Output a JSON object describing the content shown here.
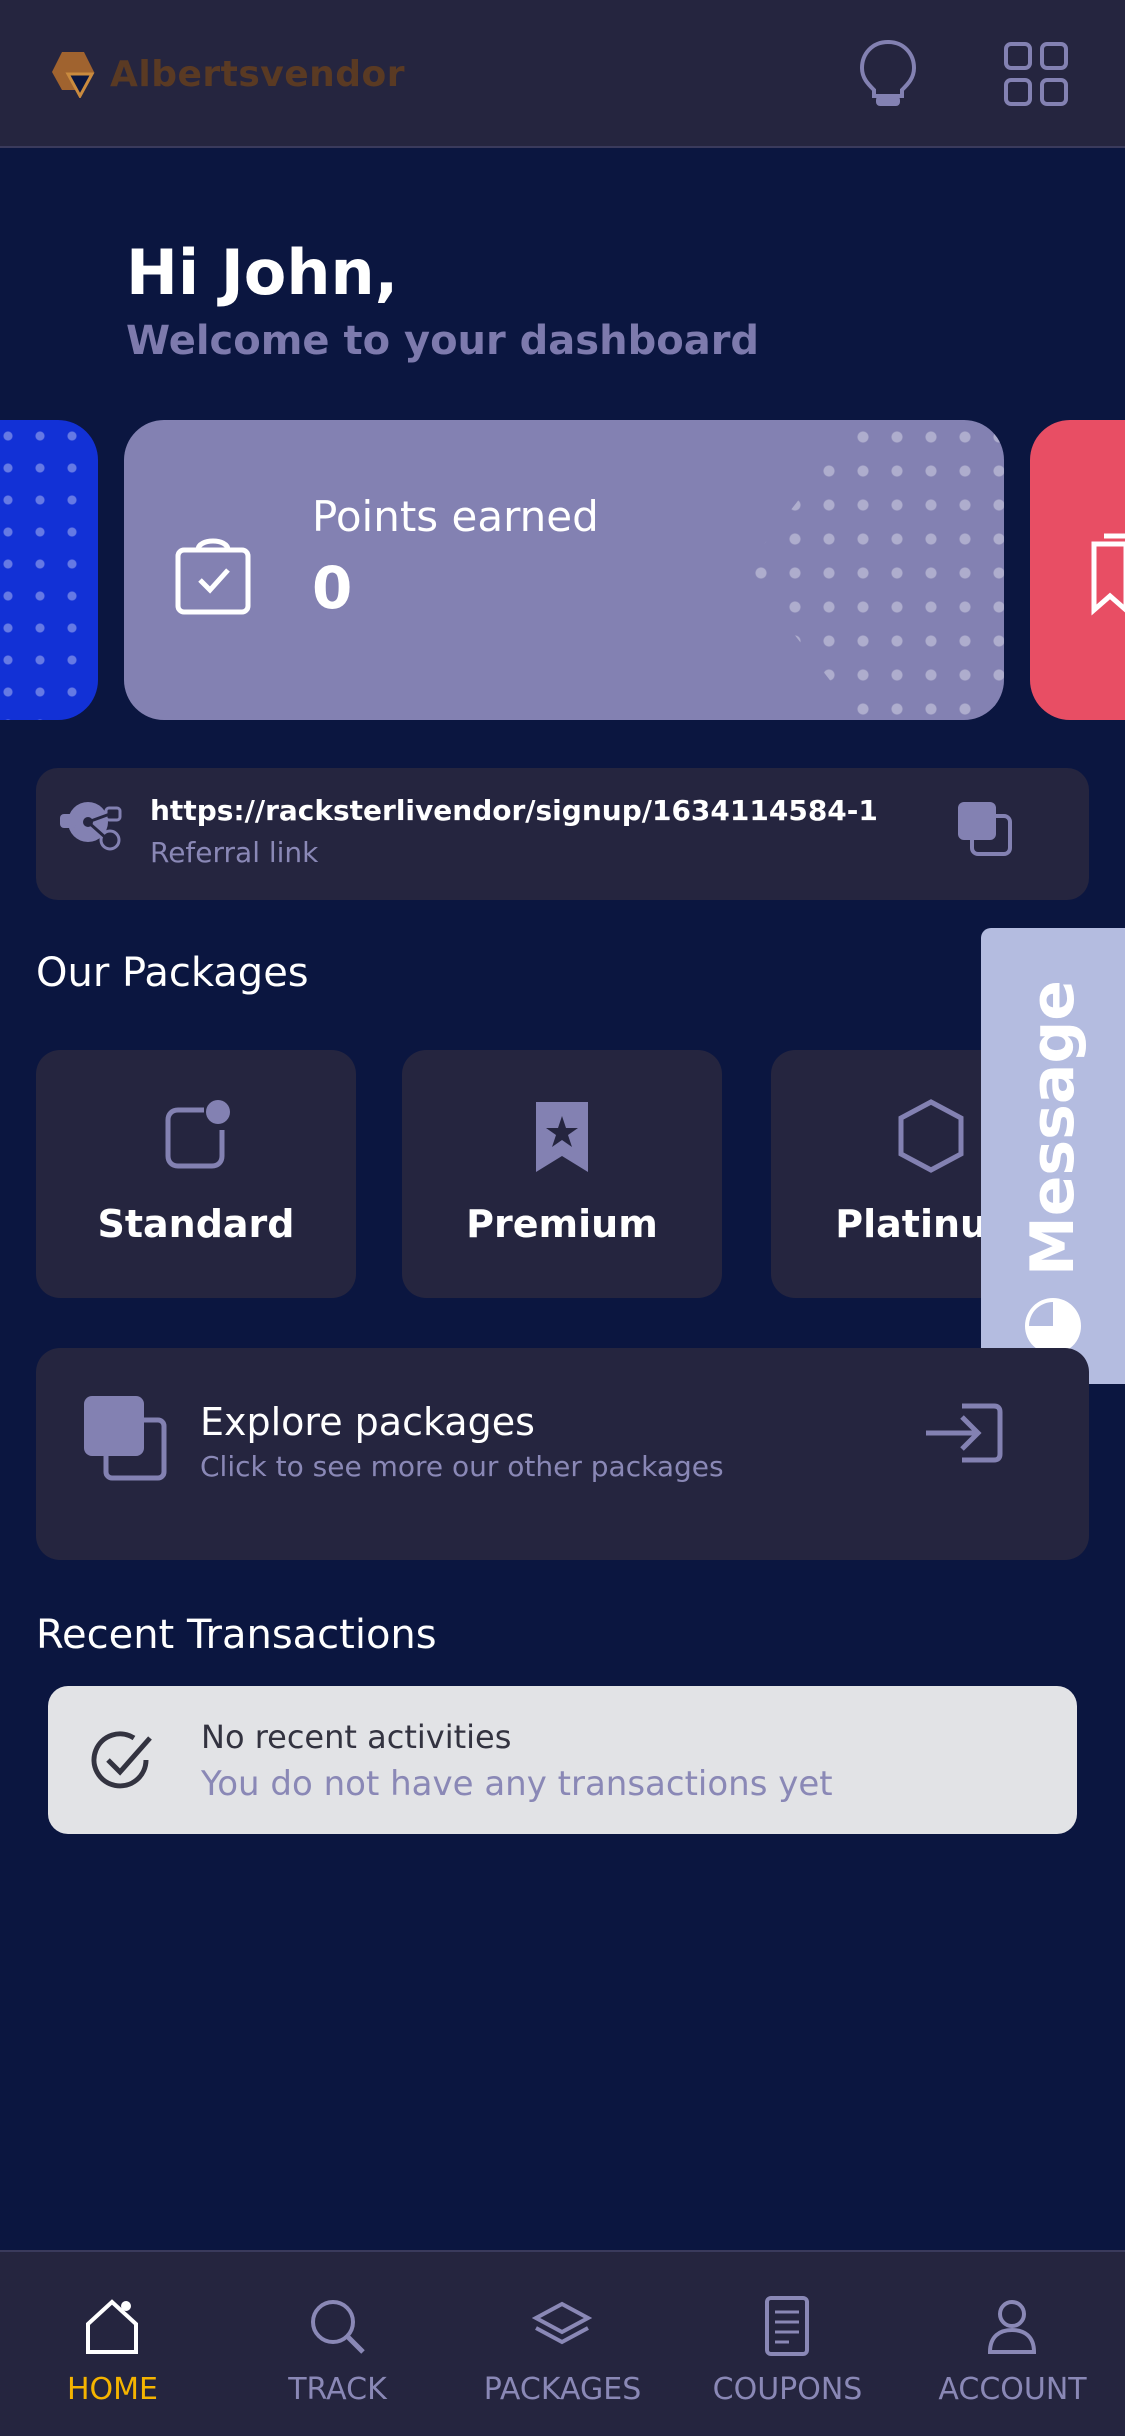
{
  "header": {
    "brand_name": "Albertsvendor",
    "icons": [
      "bulb-icon",
      "grid-menu-icon"
    ]
  },
  "greeting": {
    "title": "Hi John,",
    "subtitle": "Welcome to your dashboard"
  },
  "points_card": {
    "label": "Points earned",
    "value": "0",
    "icon": "shopping-bag-check-icon"
  },
  "referral": {
    "url": "https://racksterlivendor/signup/1634114584-1",
    "label": "Referral link"
  },
  "packages": {
    "title": "Our Packages",
    "items": [
      {
        "label": "Standard",
        "icon": "badge-dot-icon"
      },
      {
        "label": "Premium",
        "icon": "bookmark-star-icon"
      },
      {
        "label": "Platinum",
        "icon": "hexagon-icon"
      }
    ]
  },
  "message_tab": {
    "label": "Message"
  },
  "explore": {
    "title": "Explore packages",
    "subtitle": "Click to see more our other packages"
  },
  "transactions": {
    "title": "Recent Transactions",
    "empty_title": "No recent activities",
    "empty_subtitle": "You do not have any transactions yet"
  },
  "bottom_nav": {
    "items": [
      {
        "label": "HOME",
        "icon": "home-icon",
        "active": true
      },
      {
        "label": "TRACK",
        "icon": "search-icon",
        "active": false
      },
      {
        "label": "PACKAGES",
        "icon": "layers-icon",
        "active": false
      },
      {
        "label": "COUPONS",
        "icon": "document-icon",
        "active": false
      },
      {
        "label": "ACCOUNT",
        "icon": "user-icon",
        "active": false
      }
    ]
  },
  "colors": {
    "background": "#0b1640",
    "surface": "#25253f",
    "points_card": "#8381b2",
    "accent_active": "#f5b400",
    "blue_card": "#1231d6",
    "red_card": "#e84e64",
    "muted_text": "#8a88b6"
  }
}
